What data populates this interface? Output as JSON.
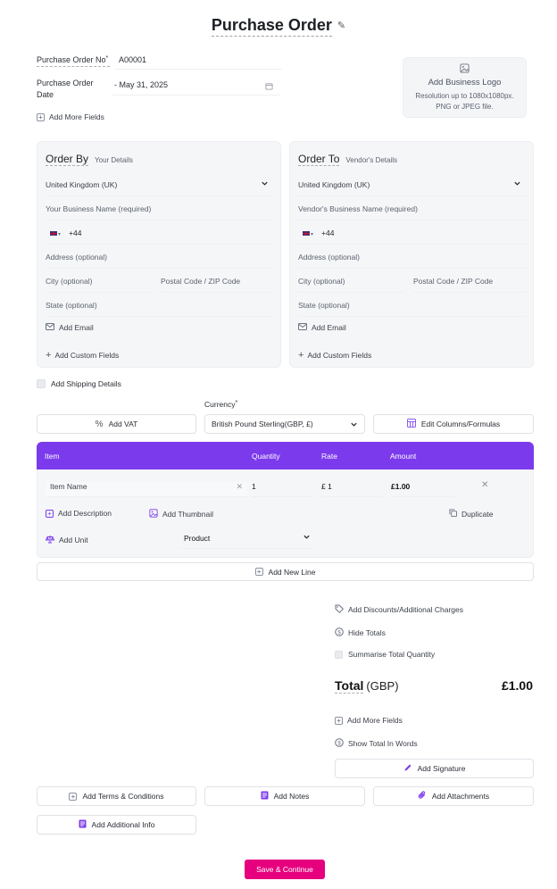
{
  "page": {
    "title": "Purchase Order"
  },
  "header": {
    "po_no_label": "Purchase Order No",
    "po_no_star": "*",
    "po_no_value": "A00001",
    "date_label_1": "Purchase Order",
    "date_label_2": "Date",
    "date_value": "- May 31, 2025",
    "add_more_fields": "Add More Fields",
    "logo_title": "Add Business Logo",
    "logo_hint_1": "Resolution up to 1080x1080px.",
    "logo_hint_2": "PNG or JPEG file."
  },
  "order_by": {
    "title": "Order By",
    "subtitle": "Your Details",
    "country": "United Kingdom (UK)",
    "business_name_placeholder": "Your Business Name (required)",
    "phone_code": "+44",
    "address_placeholder": "Address (optional)",
    "city_placeholder": "City (optional)",
    "postal_placeholder": "Postal Code / ZIP Code",
    "state_placeholder": "State (optional)",
    "add_email": "Add Email",
    "add_custom_fields": "Add Custom Fields"
  },
  "order_to": {
    "title": "Order To",
    "subtitle": "Vendor's Details",
    "country": "United Kingdom (UK)",
    "business_name_placeholder": "Vendor's Business Name (required)",
    "phone_code": "+44",
    "address_placeholder": "Address (optional)",
    "city_placeholder": "City (optional)",
    "postal_placeholder": "Postal Code / ZIP Code",
    "state_placeholder": "State (optional)",
    "add_email": "Add Email",
    "add_custom_fields": "Add Custom Fields"
  },
  "shipping": {
    "label": "Add Shipping Details"
  },
  "currency": {
    "label": "Currency",
    "star": "*",
    "value": "British Pound Sterling(GBP, £)"
  },
  "toolbar": {
    "add_vat": "Add VAT",
    "edit_columns": "Edit Columns/Formulas"
  },
  "table": {
    "header_color": "#7c3aed",
    "columns": [
      "Item",
      "Quantity",
      "Rate",
      "Amount"
    ],
    "row": {
      "item_name": "Item Name",
      "quantity": "1",
      "rate": "£ 1",
      "amount": "£1.00",
      "add_description": "Add Description",
      "add_thumbnail": "Add Thumbnail",
      "duplicate": "Duplicate",
      "add_unit": "Add Unit",
      "unit_value": "Product"
    },
    "add_new_line": "Add New Line"
  },
  "totals": {
    "add_discounts": "Add Discounts/Additional Charges",
    "hide_totals": "Hide Totals",
    "summarise_quantity": "Summarise Total Quantity",
    "total_label": "Total",
    "total_currency": "(GBP)",
    "total_value": "£1.00",
    "add_more_fields": "Add More Fields",
    "show_total_words": "Show Total In Words",
    "add_signature": "Add Signature"
  },
  "footer": {
    "add_terms": "Add Terms & Conditions",
    "add_notes": "Add Notes",
    "add_attachments": "Add Attachments",
    "add_additional_info": "Add Additional Info",
    "save": "Save & Continue",
    "save_color": "#e6007e"
  }
}
